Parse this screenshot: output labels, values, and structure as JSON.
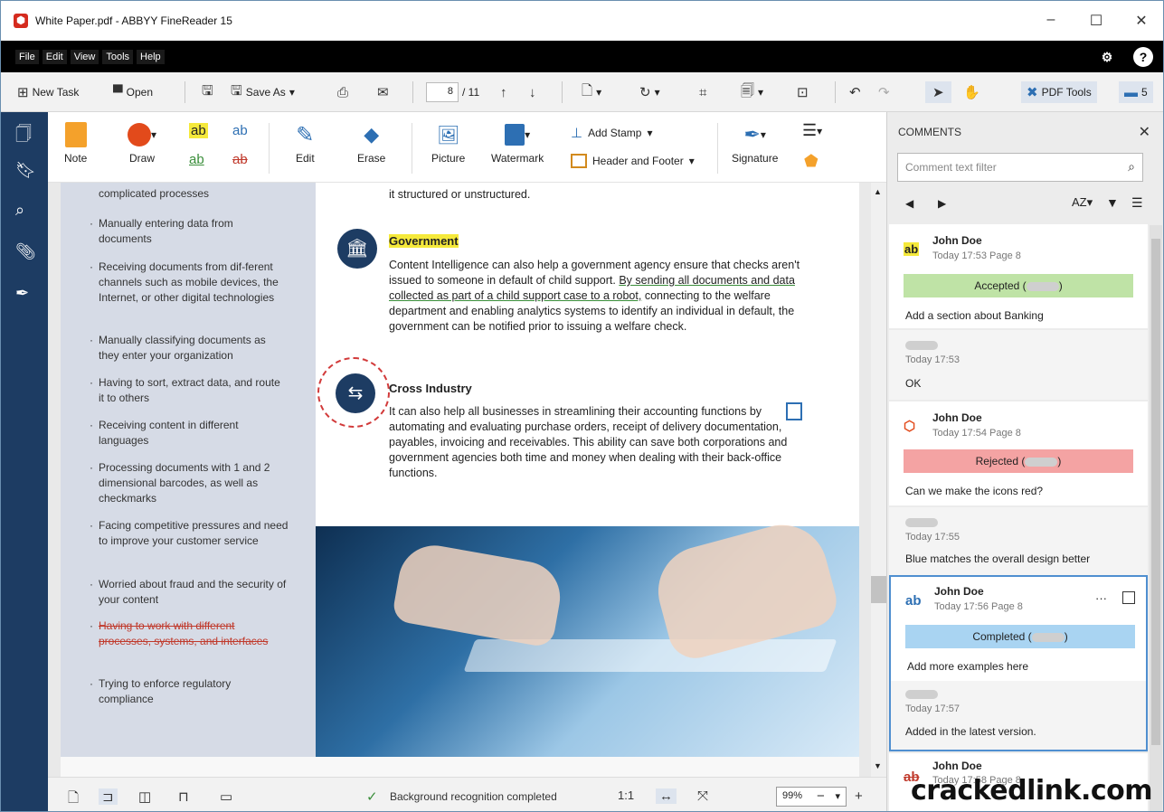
{
  "window": {
    "title": "White Paper.pdf - ABBYY FineReader 15",
    "minimize": "–",
    "maximize": "☐",
    "close": "✕"
  },
  "menu": [
    "File",
    "Edit",
    "View",
    "Tools",
    "Help"
  ],
  "toolbar": {
    "new_task": "New Task",
    "open": "Open",
    "save_as": "Save As",
    "page_current": "8",
    "page_total": "/ 11",
    "pdf_tools": "PDF Tools",
    "comments_count": "5"
  },
  "ribbon": {
    "note": "Note",
    "draw": "Draw",
    "edit": "Edit",
    "erase": "Erase",
    "picture": "Picture",
    "watermark": "Watermark",
    "add_stamp": "Add Stamp",
    "header_footer": "Header and Footer",
    "signature": "Signature",
    "highlight_ab": "ab"
  },
  "document": {
    "left_list": [
      "complicated processes",
      "Manually entering data from documents",
      "Receiving documents from dif-ferent channels such as mobile devices, the Internet, or other digital technologies",
      "Manually classifying documents as they enter your organization",
      "Having to sort, extract data, and route it to others",
      "Receiving content in different languages",
      "Processing documents with 1 and 2 dimensional barcodes, as well as checkmarks",
      "Facing competitive pressures and need to improve your customer service",
      "Worried about fraud and the security of your content",
      "Having to work with different processes, systems, and interfaces",
      "Trying to enforce regulatory compliance"
    ],
    "top_fragment": "it structured or unstructured.",
    "gov_heading": "Government",
    "gov_text_1": "Content Intelligence can also help a government agency ensure that checks aren't issued to someone in default of child support.",
    "gov_text_2": "By sending all documents and data collected as part of a child support case to a robot,",
    "gov_text_3": "connecting to the welfare department and enabling analytics systems to identify an individual in default, the government can be notified prior to issuing a welfare check.",
    "ci_heading": "Cross Industry",
    "ci_text": "It can also help all businesses in streamlining their accounting functions by automating and evaluating purchase orders, receipt of delivery documentation, payables, invoicing and receivables. This ability can save both corporations and government agencies both time and money when dealing with their back-office functions."
  },
  "status": {
    "message": "Background recognition completed",
    "ratio": "1:1",
    "zoom": "99%",
    "minus": "−",
    "plus": "+"
  },
  "comments": {
    "header": "COMMENTS",
    "filter_placeholder": "Comment text filter",
    "sort": "AZ",
    "items": [
      {
        "author": "John Doe",
        "meta": "Today 17:53  Page 8",
        "status": "Accepted (",
        "status_end": ")",
        "body": "Add a section about Banking"
      },
      {
        "author": "",
        "meta": "Today 17:53",
        "body": "OK"
      },
      {
        "author": "John Doe",
        "meta": "Today 17:54  Page 8",
        "status": "Rejected (",
        "status_end": ")",
        "body": "Can we make the icons red?"
      },
      {
        "author": "",
        "meta": "Today 17:55",
        "body": "Blue matches the overall design better"
      },
      {
        "author": "John Doe",
        "meta": "Today 17:56  Page 8",
        "status": "Completed (",
        "status_end": ")",
        "body": "Add more examples here",
        "more": "···"
      },
      {
        "author": "",
        "meta": "Today 17:57",
        "body": "Added in the latest version."
      },
      {
        "author": "John Doe",
        "meta": "Today 17:58  Page 8"
      }
    ]
  },
  "watermark": "crackedlink.com",
  "colors": {
    "rail": "#1d3c63",
    "accepted": "#bfe3a6",
    "rejected": "#f4a3a3",
    "completed": "#a9d4f2",
    "highlight": "#f5e93b"
  }
}
